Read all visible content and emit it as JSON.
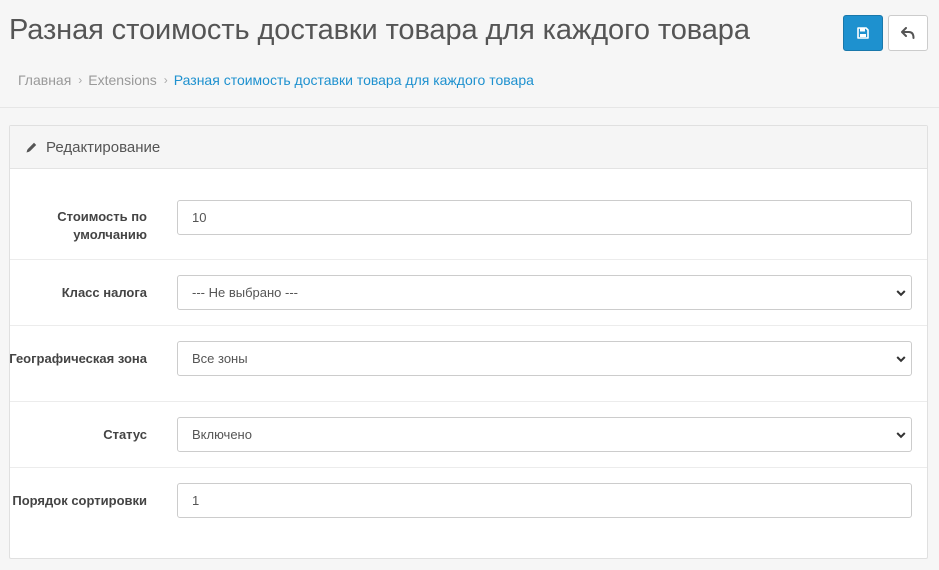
{
  "header": {
    "title": "Разная стоимость доставки товара для каждого товара"
  },
  "breadcrumb": {
    "items": [
      {
        "label": "Главная"
      },
      {
        "label": "Extensions"
      },
      {
        "label": "Разная стоимость доставки товара для каждого товара"
      }
    ]
  },
  "panel": {
    "title": "Редактирование"
  },
  "form": {
    "default_cost": {
      "label": "Стоимость по умолчанию",
      "value": "10"
    },
    "tax_class": {
      "label": "Класс налога",
      "selected": "--- Не выбрано ---"
    },
    "geo_zone": {
      "label": "Географическая зона",
      "selected": "Все зоны"
    },
    "status": {
      "label": "Статус",
      "selected": "Включено"
    },
    "sort_order": {
      "label": "Порядок сортировки",
      "value": "1"
    }
  },
  "icons": {
    "save": "save-icon",
    "back": "reply-icon",
    "edit": "pencil-icon"
  },
  "colors": {
    "primary": "#1e91cf",
    "link": "#1e91cf"
  }
}
